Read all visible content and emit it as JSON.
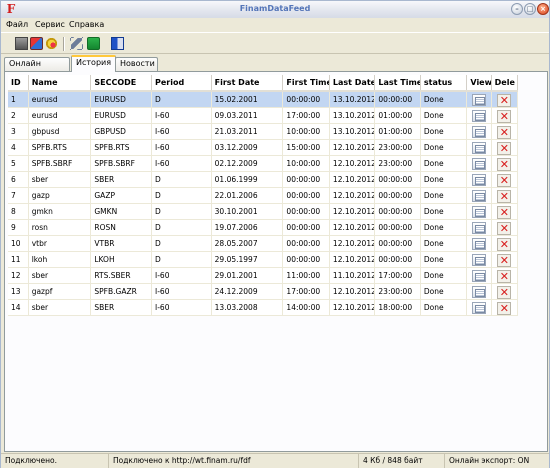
{
  "window": {
    "title": "FinamDataFeed",
    "app_icon_glyph": "F"
  },
  "menu": [
    "Файл",
    "Сервис",
    "Справка"
  ],
  "toolbar": [
    {
      "icon": "stop-icon"
    },
    {
      "icon": "connect-icon"
    },
    {
      "icon": "settings-icon"
    },
    {
      "icon": "tools-icon"
    },
    {
      "icon": "export-icon"
    },
    {
      "icon": "book-icon"
    }
  ],
  "tabs": [
    {
      "label": "Онлайн Данные",
      "active": false
    },
    {
      "label": "История",
      "active": true
    },
    {
      "label": "Новости",
      "active": false
    }
  ],
  "table": {
    "columns": [
      "ID",
      "Name",
      "SECCODE",
      "Period",
      "First Date",
      "First Time",
      "Last Date",
      "Last Time",
      "status",
      "View",
      "Dele"
    ],
    "selected_row": 0,
    "rows": [
      [
        "1",
        "eurusd",
        "EURUSD",
        "D",
        "15.02.2001",
        "00:00:00",
        "13.10.2012",
        "00:00:00",
        "Done"
      ],
      [
        "2",
        "eurusd",
        "EURUSD",
        "I-60",
        "09.03.2011",
        "17:00:00",
        "13.10.2012",
        "01:00:00",
        "Done"
      ],
      [
        "3",
        "gbpusd",
        "GBPUSD",
        "I-60",
        "21.03.2011",
        "10:00:00",
        "13.10.2012",
        "01:00:00",
        "Done"
      ],
      [
        "4",
        "SPFB.RTS",
        "SPFB.RTS",
        "I-60",
        "03.12.2009",
        "15:00:00",
        "12.10.2012",
        "23:00:00",
        "Done"
      ],
      [
        "5",
        "SPFB.SBRF",
        "SPFB.SBRF",
        "I-60",
        "02.12.2009",
        "10:00:00",
        "12.10.2012",
        "23:00:00",
        "Done"
      ],
      [
        "6",
        "sber",
        "SBER",
        "D",
        "01.06.1999",
        "00:00:00",
        "12.10.2012",
        "00:00:00",
        "Done"
      ],
      [
        "7",
        "gazp",
        "GAZP",
        "D",
        "22.01.2006",
        "00:00:00",
        "12.10.2012",
        "00:00:00",
        "Done"
      ],
      [
        "8",
        "gmkn",
        "GMKN",
        "D",
        "30.10.2001",
        "00:00:00",
        "12.10.2012",
        "00:00:00",
        "Done"
      ],
      [
        "9",
        "rosn",
        "ROSN",
        "D",
        "19.07.2006",
        "00:00:00",
        "12.10.2012",
        "00:00:00",
        "Done"
      ],
      [
        "10",
        "vtbr",
        "VTBR",
        "D",
        "28.05.2007",
        "00:00:00",
        "12.10.2012",
        "00:00:00",
        "Done"
      ],
      [
        "11",
        "lkoh",
        "LKOH",
        "D",
        "29.05.1997",
        "00:00:00",
        "12.10.2012",
        "00:00:00",
        "Done"
      ],
      [
        "12",
        "sber",
        "RTS.SBER",
        "I-60",
        "29.01.2001",
        "11:00:00",
        "11.10.2012",
        "17:00:00",
        "Done"
      ],
      [
        "13",
        "gazpf",
        "SPFB.GAZR",
        "I-60",
        "24.12.2009",
        "17:00:00",
        "12.10.2012",
        "23:00:00",
        "Done"
      ],
      [
        "14",
        "sber",
        "SBER",
        "I-60",
        "13.03.2008",
        "14:00:00",
        "12.10.2012",
        "18:00:00",
        "Done"
      ]
    ]
  },
  "statusbar": {
    "connection": "Подключено.",
    "server": "Подключено к http://wt.finam.ru/fdf",
    "traffic": "4 Кб / 848 байт",
    "online_export": "Онлайн экспорт: ON"
  }
}
